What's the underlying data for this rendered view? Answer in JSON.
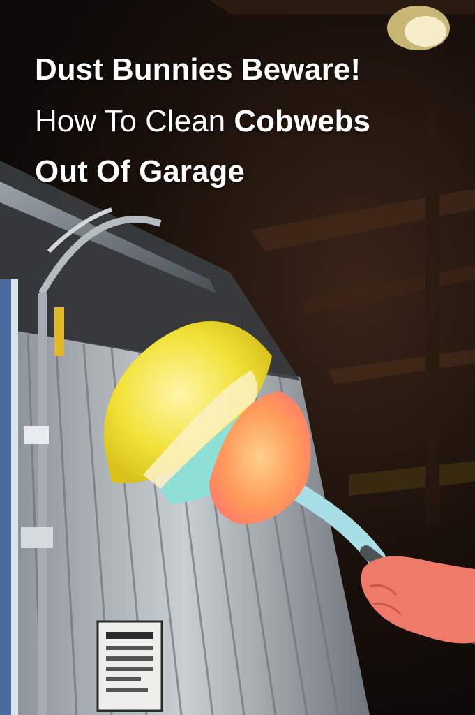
{
  "headline": {
    "line1": "Dust Bunnies Beware!",
    "line2_light": "How To Clean ",
    "line2_bold": "Cobwebs",
    "line3": "Out Of Garage"
  },
  "scene": {
    "subject": "duster-illustration",
    "colors": {
      "duster_yellow": "#f2e23a",
      "duster_aqua": "#8ee0d6",
      "duster_orange": "#ff9a5a",
      "handle": "#a8dfe6",
      "hand": "#f07a6a",
      "garage_door": "#b9bfc4"
    }
  }
}
